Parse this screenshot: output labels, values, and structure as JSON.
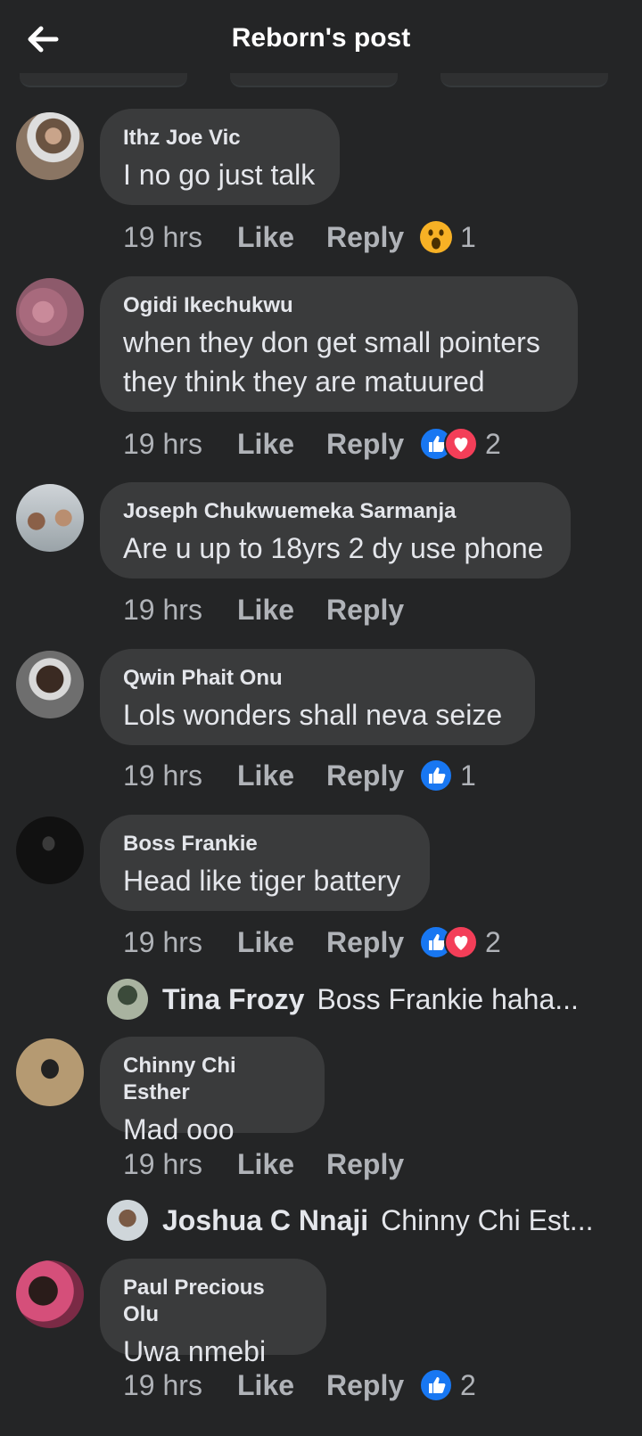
{
  "header": {
    "title": "Reborn's post"
  },
  "comments": [
    {
      "author": "Ithz Joe Vic",
      "text": "I no go just talk",
      "time": "19 hrs",
      "like": "Like",
      "reply": "Reply",
      "reactions": [
        "wow"
      ],
      "count": "1"
    },
    {
      "author": "Ogidi Ikechukwu",
      "text": "when they don get small pointers they think they are matuured",
      "time": "19 hrs",
      "like": "Like",
      "reply": "Reply",
      "reactions": [
        "like",
        "love"
      ],
      "count": "2"
    },
    {
      "author": "Joseph Chukwuemeka Sarmanja",
      "text": "Are u up to 18yrs 2 dy use phone",
      "time": "19 hrs",
      "like": "Like",
      "reply": "Reply",
      "reactions": [],
      "count": ""
    },
    {
      "author": "Qwin Phait Onu",
      "text": "Lols wonders shall neva seize",
      "time": "19 hrs",
      "like": "Like",
      "reply": "Reply",
      "reactions": [
        "like"
      ],
      "count": "1"
    },
    {
      "author": "Boss Frankie",
      "text": "Head like tiger battery",
      "time": "19 hrs",
      "like": "Like",
      "reply": "Reply",
      "reactions": [
        "like",
        "love"
      ],
      "count": "2",
      "reply_preview": {
        "name": "Tina Frozy",
        "text": "Boss Frankie haha..."
      }
    },
    {
      "author": "Chinny Chi Esther",
      "text": "Mad ooo",
      "time": "19 hrs",
      "like": "Like",
      "reply": "Reply",
      "reactions": [],
      "count": "",
      "reply_preview": {
        "name": "Joshua C Nnaji",
        "text": "Chinny Chi Est..."
      }
    },
    {
      "author": "Paul Precious Olu",
      "text": "Uwa nmebi",
      "time": "19 hrs",
      "like": "Like",
      "reply": "Reply",
      "reactions": [
        "like"
      ],
      "count": "2"
    }
  ],
  "colors": {
    "background": "#242526",
    "bubble": "#3a3b3c",
    "like_blue": "#1877f2",
    "love_red": "#f33e58",
    "wow_yellow": "#f7b125"
  }
}
